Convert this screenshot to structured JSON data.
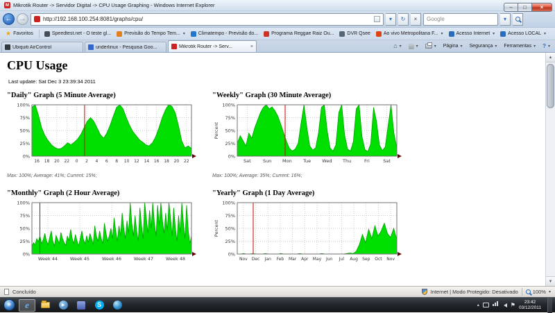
{
  "colors": {
    "graph_fill": "#00e000",
    "graph_outline": "#00a000",
    "red_line": "#cc0000",
    "grid": "#b8b8b8",
    "accent_blue": "#2b6cb8"
  },
  "icons": {
    "star": "★",
    "dropdown": "▾",
    "back": "←",
    "forward": "→",
    "refresh": "↻",
    "stop": "×",
    "close": "×",
    "minimize": "–",
    "maximize": "□",
    "home": "⌂",
    "help": "?",
    "tray_up": "▴",
    "flag": "⚑",
    "play": "▶",
    "scroll_up": "▲",
    "scroll_down": "▼",
    "skype_s": "S",
    "mikrotik_m": "M"
  },
  "window": {
    "title": "Mikrotik Router -> Servidor Digital -> CPU Usage Graphing - Windows Internet Explorer"
  },
  "address_bar": {
    "url": "http://192.168.100.254:8081/graphs/cpu/",
    "search_text": "Google"
  },
  "favorites_bar": {
    "label": "Favoritos",
    "items": [
      {
        "label": "Speedtest.net - O teste gl...",
        "icon_color": "#444c55",
        "dropdown": false
      },
      {
        "label": "Previsão do Tempo  Tem...",
        "icon_color": "#e08020",
        "dropdown": true
      },
      {
        "label": "Climatempo - Previsão do...",
        "icon_color": "#2277cc",
        "dropdown": false
      },
      {
        "label": "Programa Reggae Raiz Ou...",
        "icon_color": "#cc3322",
        "dropdown": false
      },
      {
        "label": "DVR Qsee",
        "icon_color": "#556677",
        "dropdown": false
      },
      {
        "label": "Ao vivo  Metropolitana F...",
        "icon_color": "#dd4411",
        "dropdown": true
      },
      {
        "label": "Acesso Internet",
        "icon_color": "#2b6cb8",
        "dropdown": true
      },
      {
        "label": "Acesso LOCAL",
        "icon_color": "#2b6cb8",
        "dropdown": true
      }
    ]
  },
  "tabs": [
    {
      "label": "Ubiquiti AirControl",
      "icon_color": "#303840",
      "active": false
    },
    {
      "label": "underlinux - Pesquisa Goo...",
      "icon_color": "#3366cc",
      "active": false
    },
    {
      "label": "Mikrotik Router -> Serv...",
      "icon_color": "#cc2222",
      "active": true
    }
  ],
  "command_bar": {
    "page_label": "Página",
    "safety_label": "Segurança",
    "tools_label": "Ferramentas"
  },
  "page": {
    "heading": "CPU Usage",
    "last_update": "Last update: Sat Dec 3 23:39:34 2011"
  },
  "chart_data": [
    {
      "id": "daily",
      "type": "area",
      "title": "\"Daily\" Graph (5 Minute Average)",
      "stats": "Max: 100%; Average: 41%; Current: 15%;",
      "ylabel": "",
      "ylim": [
        0,
        100
      ],
      "ytick_labels": [
        "0%",
        "25%",
        "50%",
        "75%",
        "100%"
      ],
      "xtick_labels": [
        "16",
        "18",
        "20",
        "22",
        "0",
        "2",
        "4",
        "6",
        "8",
        "10",
        "12",
        "14",
        "16",
        "18",
        "20",
        "22"
      ],
      "red_line_frac": 0.33,
      "values": [
        95,
        100,
        80,
        55,
        40,
        30,
        22,
        17,
        14,
        15,
        20,
        26,
        22,
        27,
        33,
        42,
        55,
        68,
        75,
        68,
        55,
        42,
        35,
        45,
        60,
        78,
        95,
        100,
        92,
        75,
        60,
        48,
        40,
        32,
        27,
        22,
        20,
        26,
        38,
        55,
        75,
        90,
        100,
        97,
        85,
        60,
        30,
        16,
        20,
        15
      ]
    },
    {
      "id": "weekly",
      "type": "area",
      "title": "\"Weekly\" Graph (30 Minute Average)",
      "stats": "Max: 100%; Average: 35%; Current: 16%;",
      "ylabel": "Percent",
      "ylim": [
        0,
        100
      ],
      "ytick_labels": [
        "0%",
        "25%",
        "50%",
        "75%",
        "100%"
      ],
      "xtick_labels": [
        "Sat",
        "Sun",
        "Mon",
        "Tue",
        "Wed",
        "Thu",
        "Fri",
        "Sat"
      ],
      "red_line_frac": 0.3,
      "values": [
        25,
        40,
        30,
        20,
        45,
        35,
        55,
        70,
        85,
        95,
        100,
        92,
        96,
        88,
        78,
        62,
        45,
        28,
        15,
        10,
        14,
        25,
        65,
        100,
        55,
        20,
        12,
        16,
        45,
        95,
        100,
        50,
        16,
        10,
        22,
        85,
        100,
        42,
        14,
        10,
        28,
        92,
        100,
        38,
        13,
        9,
        24,
        95,
        68,
        22,
        11,
        18,
        60,
        100,
        45,
        16
      ]
    },
    {
      "id": "monthly",
      "type": "area",
      "title": "\"Monthly\" Graph (2 Hour Average)",
      "ylabel": "",
      "ylim": [
        0,
        100
      ],
      "ytick_labels": [
        "0%",
        "25%",
        "50%",
        "75%",
        "100%"
      ],
      "xtick_labels": [
        "Week 44",
        "Week 45",
        "Week 46",
        "Week 47",
        "Week 48"
      ],
      "red_line_frac": 0.05,
      "values": [
        15,
        22,
        18,
        30,
        24,
        35,
        20,
        28,
        40,
        26,
        18,
        32,
        45,
        24,
        16,
        36,
        28,
        20,
        42,
        30,
        22,
        17,
        35,
        26,
        48,
        30,
        20,
        38,
        25,
        16,
        30,
        45,
        28,
        20,
        36,
        22,
        40,
        30,
        18,
        55,
        35,
        25,
        45,
        30,
        20,
        60,
        40,
        25,
        35,
        50,
        30,
        70,
        45,
        25,
        55,
        35,
        80,
        50,
        30,
        65,
        40,
        100,
        60,
        35,
        75,
        45,
        25,
        90,
        55,
        30,
        100,
        70,
        40,
        85,
        50,
        100,
        60,
        35,
        95,
        55,
        100,
        65,
        40,
        80,
        45,
        100,
        70,
        35,
        90,
        50,
        25,
        75,
        40,
        100,
        60,
        30,
        95,
        45,
        20,
        35
      ]
    },
    {
      "id": "yearly",
      "type": "area",
      "title": "\"Yearly\" Graph (1 Day Average)",
      "ylabel": "Percent",
      "ylim": [
        0,
        100
      ],
      "ytick_labels": [
        "0%",
        "25%",
        "50%",
        "75%",
        "100%"
      ],
      "xtick_labels": [
        "Nov",
        "Dec",
        "Jan",
        "Feb",
        "Mar",
        "Apr",
        "May",
        "Jun",
        "Jul",
        "Aug",
        "Sep",
        "Oct",
        "Nov"
      ],
      "red_line_frac": 0.1,
      "values": [
        0,
        0,
        1,
        0,
        0,
        1,
        0,
        0,
        0,
        1,
        0,
        0,
        0,
        0,
        1,
        0,
        0,
        0,
        0,
        0,
        1,
        0,
        0,
        0,
        0,
        0,
        0,
        1,
        0,
        0,
        0,
        0,
        0,
        0,
        0,
        1,
        2,
        1,
        5,
        18,
        38,
        22,
        48,
        30,
        55,
        35,
        45,
        60,
        40,
        32,
        50,
        28
      ]
    }
  ],
  "status_bar": {
    "status": "Concluído",
    "zone": "Internet | Modo Protegido: Desativado",
    "zoom": "100%"
  },
  "taskbar": {
    "apps": [
      {
        "name": "internet-explorer",
        "active": true
      },
      {
        "name": "windows-explorer",
        "active": false
      },
      {
        "name": "windows-media-player",
        "active": false
      },
      {
        "name": "application-blue",
        "active": false
      },
      {
        "name": "skype",
        "active": false
      },
      {
        "name": "google-earth",
        "active": false
      }
    ],
    "clock_time": "23:42",
    "clock_date": "03/12/2011"
  }
}
